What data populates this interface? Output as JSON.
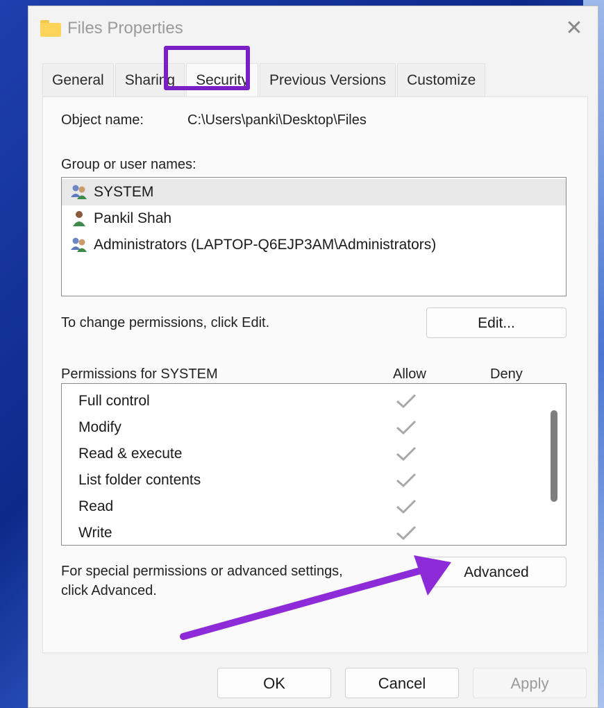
{
  "window": {
    "title": "Files Properties",
    "close_glyph": "✕"
  },
  "tabs": [
    {
      "label": "General"
    },
    {
      "label": "Sharing"
    },
    {
      "label": "Security"
    },
    {
      "label": "Previous Versions"
    },
    {
      "label": "Customize"
    }
  ],
  "security": {
    "object_name_label": "Object name:",
    "object_name_value": "C:\\Users\\panki\\Desktop\\Files",
    "group_label": "Group or user names:",
    "users": [
      {
        "name": "SYSTEM",
        "icon": "user-group-icon"
      },
      {
        "name": "Pankil Shah",
        "icon": "user-icon"
      },
      {
        "name": "Administrators (LAPTOP-Q6EJP3AM\\Administrators)",
        "icon": "user-group-icon"
      }
    ],
    "change_text": "To change permissions, click Edit.",
    "edit_label": "Edit...",
    "permissions_label": "Permissions for SYSTEM",
    "allow_header": "Allow",
    "deny_header": "Deny",
    "permissions": [
      {
        "name": "Full control",
        "allow": true,
        "deny": false
      },
      {
        "name": "Modify",
        "allow": true,
        "deny": false
      },
      {
        "name": "Read & execute",
        "allow": true,
        "deny": false
      },
      {
        "name": "List folder contents",
        "allow": true,
        "deny": false
      },
      {
        "name": "Read",
        "allow": true,
        "deny": false
      },
      {
        "name": "Write",
        "allow": true,
        "deny": false
      }
    ],
    "special_text_line1": "For special permissions or advanced settings,",
    "special_text_line2": "click Advanced.",
    "advanced_label": "Advanced"
  },
  "footer": {
    "ok_label": "OK",
    "cancel_label": "Cancel",
    "apply_label": "Apply"
  },
  "colors": {
    "highlight": "#7a1fc6",
    "arrow": "#8e2bd9"
  }
}
